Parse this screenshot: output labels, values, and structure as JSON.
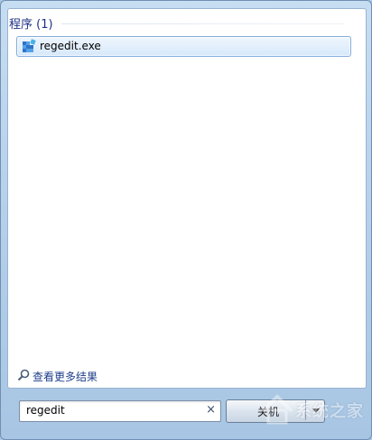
{
  "results": {
    "group_title": "程序 (1)",
    "items": [
      {
        "label": "regedit.exe",
        "icon": "registry-editor-icon"
      }
    ]
  },
  "more_results": {
    "label": "查看更多结果",
    "icon": "search-icon"
  },
  "search": {
    "value": "regedit",
    "clear_icon": "×"
  },
  "action_button": {
    "label": "关机"
  },
  "watermark": {
    "text": "系统之家"
  },
  "colors": {
    "accent": "#1e3287",
    "selection_border": "#84acdd",
    "frame": "#b1cde8"
  }
}
